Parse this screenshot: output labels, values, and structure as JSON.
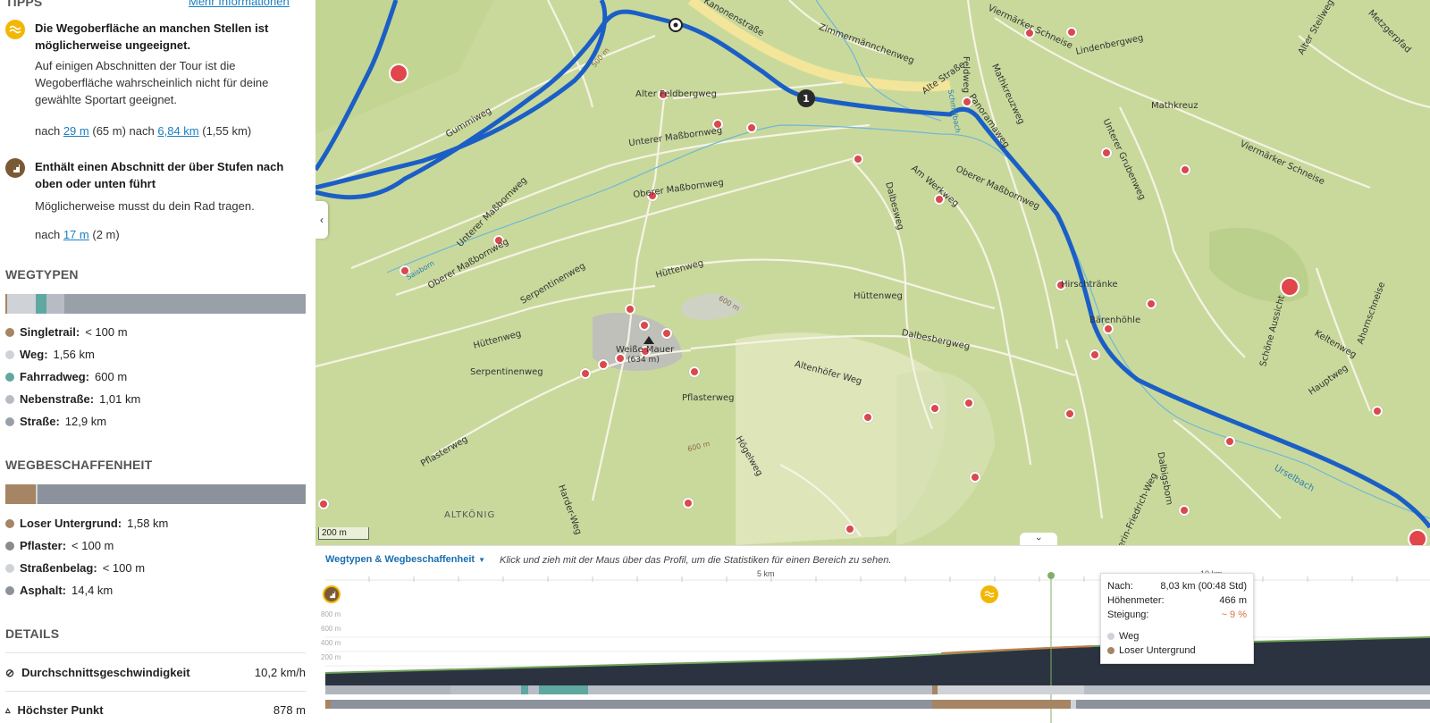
{
  "sidebar": {
    "tips_header": "TIPPS",
    "more_info_link": "Mehr Informationen",
    "tip1": {
      "title": "Die Wegoberfläche an manchen Stellen ist möglicherweise ungeeignet.",
      "text": "Auf einigen Abschnitten der Tour ist die Wegoberfläche wahrscheinlich nicht für deine gewählte Sportart geeignet.",
      "after1_prefix": "nach",
      "after1_link": "29 m",
      "after1_len": "(65 m)",
      "after2_prefix": "nach",
      "after2_link": "6,84 km",
      "after2_len": "(1,55 km)"
    },
    "tip2": {
      "title": "Enthält einen Abschnitt der über Stufen nach oben oder unten führt",
      "text": "Möglicherweise musst du dein Rad tragen.",
      "after_prefix": "nach",
      "after_link": "17 m",
      "after_len": "(2 m)"
    },
    "wegtypen": {
      "header": "WEGTYPEN",
      "items": [
        {
          "label": "Singletrail:",
          "value": "< 100 m",
          "color": "#a58563"
        },
        {
          "label": "Weg:",
          "value": "1,56 km",
          "color": "#cfd3d8"
        },
        {
          "label": "Fahrradweg:",
          "value": "600 m",
          "color": "#5fa8a0"
        },
        {
          "label": "Nebenstraße:",
          "value": "1,01 km",
          "color": "#b7bcc4"
        },
        {
          "label": "Straße:",
          "value": "12,9 km",
          "color": "#9aa0a8"
        }
      ]
    },
    "wegbeschaffenheit": {
      "header": "WEGBESCHAFFENHEIT",
      "items": [
        {
          "label": "Loser Untergrund:",
          "value": "1,58 km",
          "color": "#a58563"
        },
        {
          "label": "Pflaster:",
          "value": "< 100 m",
          "color": "#8c8a86"
        },
        {
          "label": "Straßenbelag:",
          "value": "< 100 m",
          "color": "#cfd3d8"
        },
        {
          "label": "Asphalt:",
          "value": "14,4 km",
          "color": "#8b929c"
        }
      ]
    },
    "details": {
      "header": "DETAILS",
      "speed_label": "Durchschnittsgeschwindigkeit",
      "speed_value": "10,2 km/h",
      "high_label": "Höchster Punkt",
      "high_value": "878 m"
    }
  },
  "map": {
    "scale_label": "200 m",
    "waypoint_number": "1",
    "labels": {
      "kanonenstrasse": "Kanonenstraße",
      "zimmermannchenweg": "Zimmermännchenweg",
      "alter_feldbergweg": "Alter Feldbergweg",
      "gummiweg": "Gummiweg",
      "unterer_massbornweg": "Unterer Maßbornweg",
      "oberer_massbornweg": "Oberer Maßbornweg",
      "unterer_massbornweg2": "Unterer Maßbornweg",
      "oberer_massbornweg2": "Oberer Maßbornweg",
      "serpentinenweg": "Serpentinenweg",
      "huettenweg": "Hüttenweg",
      "huettenweg2": "Hüttenweg",
      "huettenweg3": "Hüttenweg",
      "serpentinenweg2": "Serpentinenweg",
      "weisse_mauer": "Weiße Mauer",
      "weisse_mauer_elev": "(634 m)",
      "pflasterweg": "Pflasterweg",
      "pflasterweg2": "Pflasterweg",
      "altenhoefer_weg": "Altenhöfer Weg",
      "dalbesbergweg": "Dalbesbergweg",
      "hoegelweg": "Högelweg",
      "altkoenig": "ALTKÖNIG",
      "am_werkweg": "Am Werkweg",
      "dalbesweg": "Dalbesweg",
      "panoramaweg": "Panoramaweg",
      "alte_strasse": "Alte Straße",
      "feldbergweg": "Feldweg",
      "mathkreuz": "Mathkreuz",
      "unterer_grubenweg": "Unterer Grubenweg",
      "viermaerker": "Viermärker Schneise",
      "viermaerker2": "Viermärker Schneise",
      "lindenbergweg": "Lindenbergweg",
      "mathkreuzweg": "Mathkreuzweg",
      "hirschtraenke": "Hirschtränke",
      "baerenhoehle": "Bärenhöhle",
      "schoene_aussicht": "Schöne Aussicht",
      "keltenweg": "Keltenweg",
      "hauptweg": "Hauptweg",
      "ahornschneise": "Ahornschneise",
      "urselbach": "Urselbach",
      "kaiserin": "Kaiserin-Friedrich-Weg",
      "dalbigsborn": "Dalbigsborn",
      "harder_weg": "Harder-Weg",
      "metzgerpfad": "Metzgerpfad",
      "alter_steilweg": "Alter Steilweg",
      "e500": "500 m",
      "e600": "600 m",
      "e600b": "600 m",
      "sauborn": "Saisborn",
      "schmidbach": "Schmidbach"
    }
  },
  "profile": {
    "dropdown_label": "Wegtypen & Wegbeschaffenheit",
    "hint": "Klick und zieh mit der Maus über das Profil, um die Statistiken für einen Bereich zu sehen.",
    "km5": "5 km",
    "km10": "10 km",
    "y800": "800 m",
    "y600": "600 m",
    "y400": "400 m",
    "y200": "200 m",
    "tooltip": {
      "nach_label": "Nach:",
      "nach_value": "8,03 km (00:48 Std)",
      "hm_label": "Höhenmeter:",
      "hm_value": "466 m",
      "steig_label": "Steigung:",
      "steig_value": "~ 9 %",
      "legend1": "Weg",
      "legend2": "Loser Untergrund"
    }
  }
}
